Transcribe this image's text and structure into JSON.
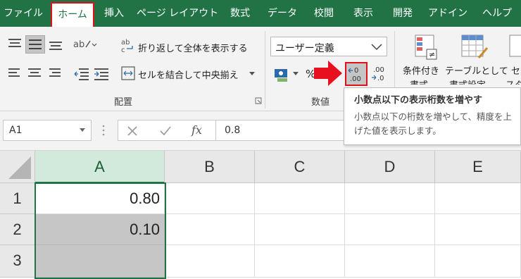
{
  "tabs": [
    {
      "label": "ファイル"
    },
    {
      "label": "ホーム"
    },
    {
      "label": "挿入"
    },
    {
      "label": "ページ レイアウト"
    },
    {
      "label": "数式"
    },
    {
      "label": "データ"
    },
    {
      "label": "校閲"
    },
    {
      "label": "表示"
    },
    {
      "label": "開発"
    },
    {
      "label": "アドイン"
    },
    {
      "label": "ヘルプ"
    }
  ],
  "ribbon": {
    "wrap_text": "折り返して全体を表示する",
    "merge_center": "セルを結合して中央揃え",
    "alignment_group": "配置",
    "number_format": "ユーザー定義",
    "percent": "%",
    "number_group": "数値",
    "increase_decimal_icon_text": "←0\n.00",
    "decrease_decimal_icon_text": ".00\n→.0",
    "conditional_format_l1": "条件付き",
    "conditional_format_l2": "書式",
    "format_table_l1": "テーブルとして",
    "format_table_l2": "書式設定",
    "cell_styles_l1": "セ",
    "cell_styles_l2": "スタ",
    "fx": "fx"
  },
  "tooltip": {
    "title": "小数点以下の表示桁数を増やす",
    "body": "小数点以下の桁数を増やして、精度を上げた値を表示します。"
  },
  "formula_bar": {
    "name_box": "A1",
    "formula": "0.8"
  },
  "grid": {
    "columns": [
      "A",
      "B",
      "C",
      "D",
      "E"
    ],
    "rows": [
      "1",
      "2",
      "3"
    ],
    "cells": {
      "A1": "0.80",
      "A2": "0.10",
      "A3": ""
    }
  },
  "colors": {
    "accent": "#217346",
    "highlight": "#e0101a",
    "arrow": "#e8101e"
  }
}
